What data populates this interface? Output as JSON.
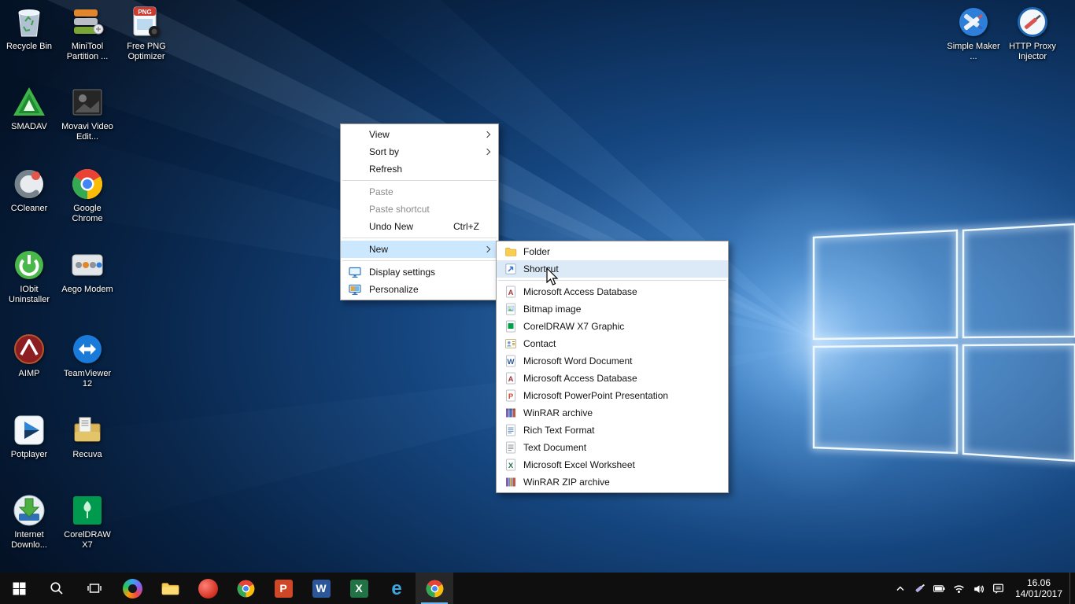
{
  "glyphs": {
    "word": "W",
    "excel": "X",
    "powerpoint": "P",
    "access": "A",
    "edge": "e",
    "png": "PNG"
  },
  "colors": {
    "accent": "#0078d7",
    "menu_highlight": "#cce8ff",
    "submenu_highlight": "#dce9f7",
    "taskbar_bg": "#0f0f0f"
  },
  "desktop": {
    "icons": [
      {
        "name": "recycle-bin",
        "label": "Recycle Bin"
      },
      {
        "name": "minitool-partition",
        "label": "MiniTool Partition ..."
      },
      {
        "name": "free-png-optimizer",
        "label": "Free PNG Optimizer"
      },
      {
        "name": "smadav",
        "label": "SMADAV"
      },
      {
        "name": "movavi-video-editor",
        "label": "Movavi Video Edit..."
      },
      {
        "name": "ccleaner",
        "label": "CCleaner"
      },
      {
        "name": "google-chrome",
        "label": "Google Chrome"
      },
      {
        "name": "iobit-uninstaller",
        "label": "IObit Uninstaller"
      },
      {
        "name": "aego-modem",
        "label": "Aego Modem"
      },
      {
        "name": "aimp",
        "label": "AIMP"
      },
      {
        "name": "teamviewer-12",
        "label": "TeamViewer 12"
      },
      {
        "name": "potplayer",
        "label": "Potplayer"
      },
      {
        "name": "recuva",
        "label": "Recuva"
      },
      {
        "name": "internet-download-manager",
        "label": "Internet Downlo..."
      },
      {
        "name": "coreldraw-x7",
        "label": "CorelDRAW X7"
      },
      {
        "name": "simple-maker",
        "label": "Simple Maker ..."
      },
      {
        "name": "http-proxy-injector",
        "label": "HTTP Proxy Injector"
      }
    ]
  },
  "context_menu": {
    "items": [
      {
        "label": "View"
      },
      {
        "label": "Sort by"
      },
      {
        "label": "Refresh"
      },
      {
        "label": "Paste"
      },
      {
        "label": "Paste shortcut"
      },
      {
        "label": "Undo New",
        "shortcut": "Ctrl+Z"
      },
      {
        "label": "New"
      },
      {
        "label": "Display settings"
      },
      {
        "label": "Personalize"
      }
    ]
  },
  "new_submenu": {
    "items": [
      {
        "label": "Folder"
      },
      {
        "label": "Shortcut"
      },
      {
        "label": "Microsoft Access Database"
      },
      {
        "label": "Bitmap image"
      },
      {
        "label": "CorelDRAW X7 Graphic"
      },
      {
        "label": "Contact"
      },
      {
        "label": "Microsoft Word Document"
      },
      {
        "label": "Microsoft Access Database"
      },
      {
        "label": "Microsoft PowerPoint Presentation"
      },
      {
        "label": "WinRAR archive"
      },
      {
        "label": "Rich Text Format"
      },
      {
        "label": "Text Document"
      },
      {
        "label": "Microsoft Excel Worksheet"
      },
      {
        "label": "WinRAR ZIP archive"
      }
    ]
  },
  "taskbar": {
    "app_icons": [
      "start",
      "search",
      "task-view",
      "colorful-app",
      "file-explorer",
      "recorder-app",
      "chrome",
      "powerpoint",
      "word",
      "excel",
      "edge",
      "chrome-active"
    ],
    "tray_icons": [
      "hidden-icons-chevron",
      "proxy-app",
      "battery",
      "network",
      "volume",
      "action-center"
    ],
    "clock": {
      "time": "16.06",
      "date": "14/01/2017"
    }
  }
}
